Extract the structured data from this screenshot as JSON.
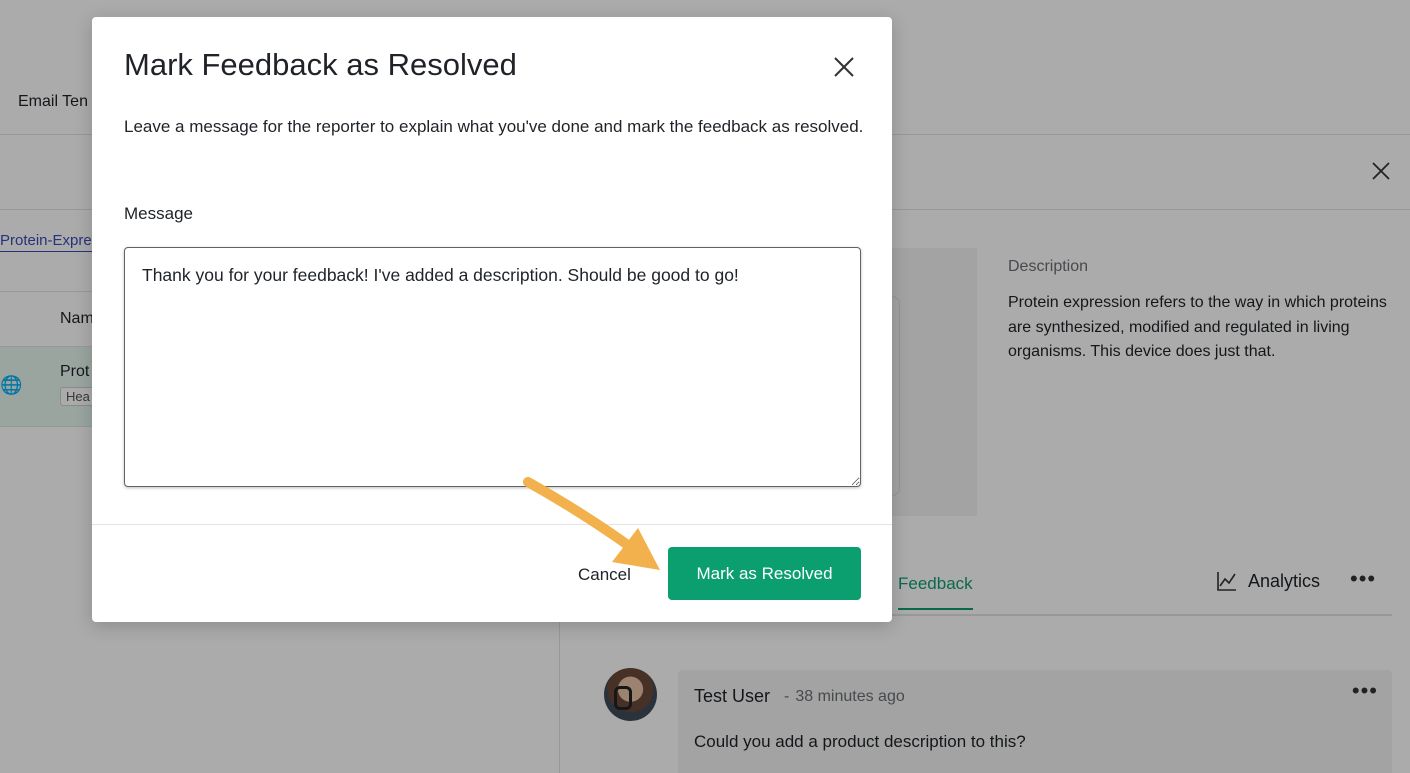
{
  "colors": {
    "accent": "#0b9e6e",
    "overlay": "rgba(0,0,0,0.33)",
    "link": "#3b4bb8",
    "annotation_arrow": "#f2b14c"
  },
  "background": {
    "nav": {
      "tab_label": "Email Ten"
    },
    "left": {
      "chip_label": "Protein-Expre",
      "column_header": "Nam",
      "row": {
        "icon": "globe-icon",
        "title": "Prot",
        "tag": "Hea"
      }
    },
    "right": {
      "description_label": "Description",
      "description_text": "Protein expression refers to the way in which proteins are synthesized, modified and regulated in living organisms. This device does just that.",
      "tabs": {
        "feedback": "Feedback",
        "analytics": "Analytics",
        "more": "•••"
      },
      "comment": {
        "author": "Test User",
        "separator": "-",
        "time": "38 minutes ago",
        "body": "Could you add a product description to this?",
        "more": "•••"
      }
    }
  },
  "modal": {
    "title": "Mark Feedback as Resolved",
    "description": "Leave a message for the reporter to explain what you've done and mark the feedback as resolved.",
    "message_label": "Message",
    "message_value": "Thank you for your feedback! I've added a description. Should be good to go!",
    "cancel_label": "Cancel",
    "submit_label": "Mark as Resolved"
  }
}
